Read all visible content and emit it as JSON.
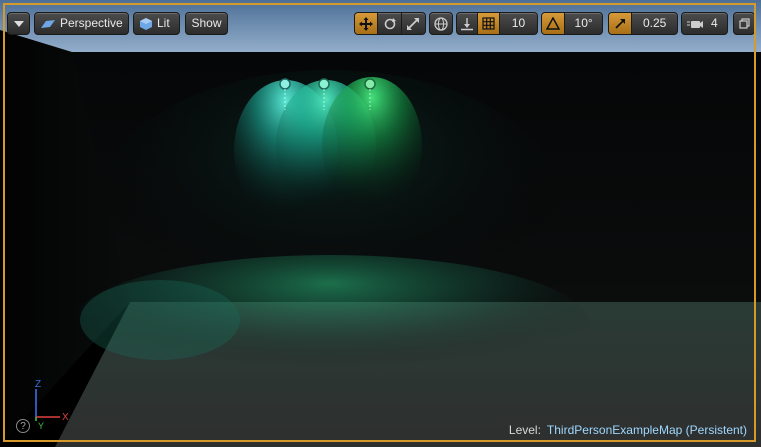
{
  "toolbar": {
    "options_menu_icon": "chevron-down-icon",
    "view_mode_label": "Perspective",
    "lighting_mode_label": "Lit",
    "show_label": "Show",
    "grid_snap_value": "10",
    "rotation_snap_value": "10°",
    "scale_snap_value": "0.25",
    "camera_speed_value": "4",
    "accent_color": "#d89a3a"
  },
  "status": {
    "level_prefix": "Level:",
    "level_name": "ThirdPersonExampleMap (Persistent)"
  },
  "axis_labels": {
    "x": "X",
    "y": "Y",
    "z": "Z"
  },
  "help_icon_text": "?",
  "lights": {
    "colors": [
      "#3fe8c9",
      "#33e8a8",
      "#2bdc6a"
    ]
  }
}
